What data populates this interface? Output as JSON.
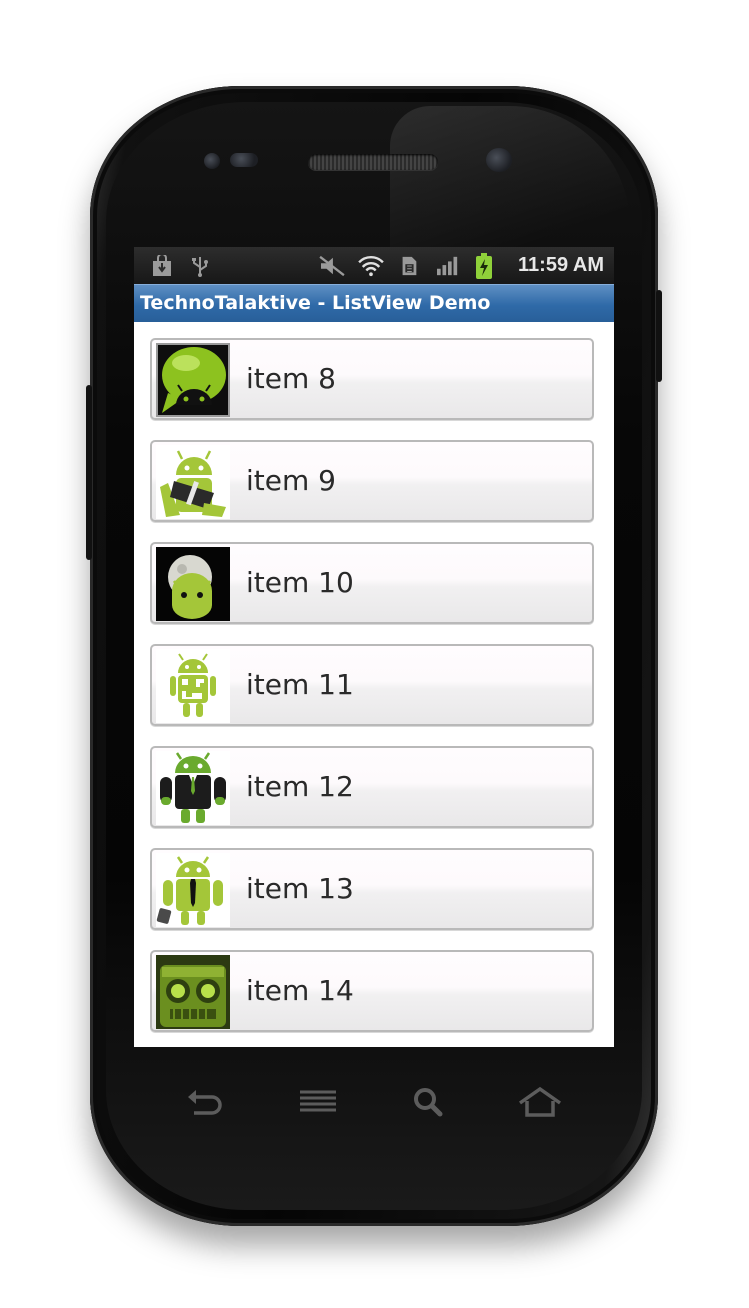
{
  "status_bar": {
    "time": "11:59 AM",
    "icons": [
      "shopping-bag-download-icon",
      "usb-icon",
      "mute-icon",
      "wifi-icon",
      "sim-icon",
      "signal-icon",
      "battery-charging-icon"
    ]
  },
  "app": {
    "title": "TechnoTalaktive - ListView Demo"
  },
  "list": {
    "items": [
      {
        "label": "item 8",
        "icon": "android-chat-bubble-icon"
      },
      {
        "label": "item 9",
        "icon": "android-ninja-icon"
      },
      {
        "label": "item 10",
        "icon": "android-moon-icon"
      },
      {
        "label": "item 11",
        "icon": "android-qr-code-icon"
      },
      {
        "label": "item 12",
        "icon": "android-business-suit-icon"
      },
      {
        "label": "item 13",
        "icon": "android-tie-briefcase-icon"
      },
      {
        "label": "item 14",
        "icon": "robot-head-icon"
      }
    ]
  },
  "nav_keys": [
    "back-key-icon",
    "menu-key-icon",
    "search-key-icon",
    "home-key-icon"
  ],
  "colors": {
    "title_bar": "#2f6aa8",
    "status_bar": "#1c1c1c",
    "android_green": "#a4c639"
  }
}
